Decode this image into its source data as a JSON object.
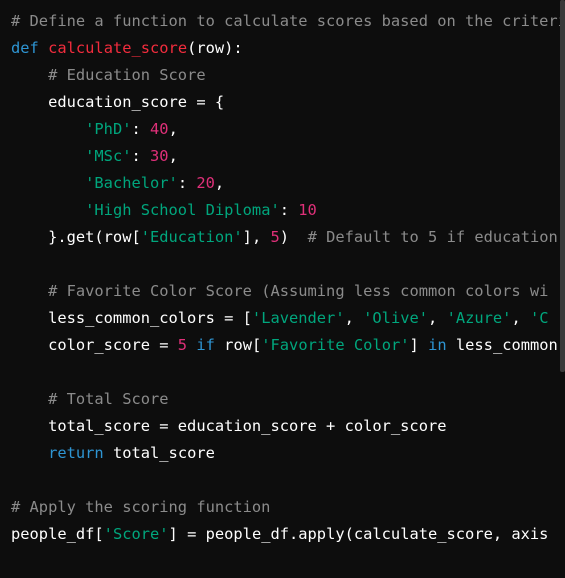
{
  "colors": {
    "background": "#0d0d0d",
    "comment": "#8b8b8b",
    "keyword": "#2e95d3",
    "function": "#f22c3d",
    "string": "#00a67d",
    "number": "#df3079",
    "plain": "#ffffff"
  },
  "code_lines": [
    [
      {
        "t": "cm",
        "v": "# Define a function to calculate scores based on the criteria"
      }
    ],
    [
      {
        "t": "kw",
        "v": "def"
      },
      {
        "t": "pl",
        "v": " "
      },
      {
        "t": "fn",
        "v": "calculate_score"
      },
      {
        "t": "pl",
        "v": "(row):"
      }
    ],
    [
      {
        "t": "pl",
        "v": "    "
      },
      {
        "t": "cm",
        "v": "# Education Score"
      }
    ],
    [
      {
        "t": "pl",
        "v": "    education_score = {"
      }
    ],
    [
      {
        "t": "pl",
        "v": "        "
      },
      {
        "t": "st",
        "v": "'PhD'"
      },
      {
        "t": "pl",
        "v": ": "
      },
      {
        "t": "nu",
        "v": "40"
      },
      {
        "t": "pl",
        "v": ","
      }
    ],
    [
      {
        "t": "pl",
        "v": "        "
      },
      {
        "t": "st",
        "v": "'MSc'"
      },
      {
        "t": "pl",
        "v": ": "
      },
      {
        "t": "nu",
        "v": "30"
      },
      {
        "t": "pl",
        "v": ","
      }
    ],
    [
      {
        "t": "pl",
        "v": "        "
      },
      {
        "t": "st",
        "v": "'Bachelor'"
      },
      {
        "t": "pl",
        "v": ": "
      },
      {
        "t": "nu",
        "v": "20"
      },
      {
        "t": "pl",
        "v": ","
      }
    ],
    [
      {
        "t": "pl",
        "v": "        "
      },
      {
        "t": "st",
        "v": "'High School Diploma'"
      },
      {
        "t": "pl",
        "v": ": "
      },
      {
        "t": "nu",
        "v": "10"
      }
    ],
    [
      {
        "t": "pl",
        "v": "    }.get(row["
      },
      {
        "t": "st",
        "v": "'Education'"
      },
      {
        "t": "pl",
        "v": "], "
      },
      {
        "t": "nu",
        "v": "5"
      },
      {
        "t": "pl",
        "v": ")  "
      },
      {
        "t": "cm",
        "v": "# Default to 5 if education"
      }
    ],
    [
      {
        "t": "pl",
        "v": ""
      }
    ],
    [
      {
        "t": "pl",
        "v": "    "
      },
      {
        "t": "cm",
        "v": "# Favorite Color Score (Assuming less common colors wi"
      }
    ],
    [
      {
        "t": "pl",
        "v": "    less_common_colors = ["
      },
      {
        "t": "st",
        "v": "'Lavender'"
      },
      {
        "t": "pl",
        "v": ", "
      },
      {
        "t": "st",
        "v": "'Olive'"
      },
      {
        "t": "pl",
        "v": ", "
      },
      {
        "t": "st",
        "v": "'Azure'"
      },
      {
        "t": "pl",
        "v": ", "
      },
      {
        "t": "st",
        "v": "'C"
      }
    ],
    [
      {
        "t": "pl",
        "v": "    color_score = "
      },
      {
        "t": "nu",
        "v": "5"
      },
      {
        "t": "pl",
        "v": " "
      },
      {
        "t": "kw",
        "v": "if"
      },
      {
        "t": "pl",
        "v": " row["
      },
      {
        "t": "st",
        "v": "'Favorite Color'"
      },
      {
        "t": "pl",
        "v": "] "
      },
      {
        "t": "kw",
        "v": "in"
      },
      {
        "t": "pl",
        "v": " less_common"
      }
    ],
    [
      {
        "t": "pl",
        "v": ""
      }
    ],
    [
      {
        "t": "pl",
        "v": "    "
      },
      {
        "t": "cm",
        "v": "# Total Score"
      }
    ],
    [
      {
        "t": "pl",
        "v": "    total_score = education_score + color_score"
      }
    ],
    [
      {
        "t": "pl",
        "v": "    "
      },
      {
        "t": "kw",
        "v": "return"
      },
      {
        "t": "pl",
        "v": " total_score"
      }
    ],
    [
      {
        "t": "pl",
        "v": ""
      }
    ],
    [
      {
        "t": "cm",
        "v": "# Apply the scoring function"
      }
    ],
    [
      {
        "t": "pl",
        "v": "people_df["
      },
      {
        "t": "st",
        "v": "'Score'"
      },
      {
        "t": "pl",
        "v": "] = people_df.apply(calculate_score, axis"
      }
    ]
  ]
}
